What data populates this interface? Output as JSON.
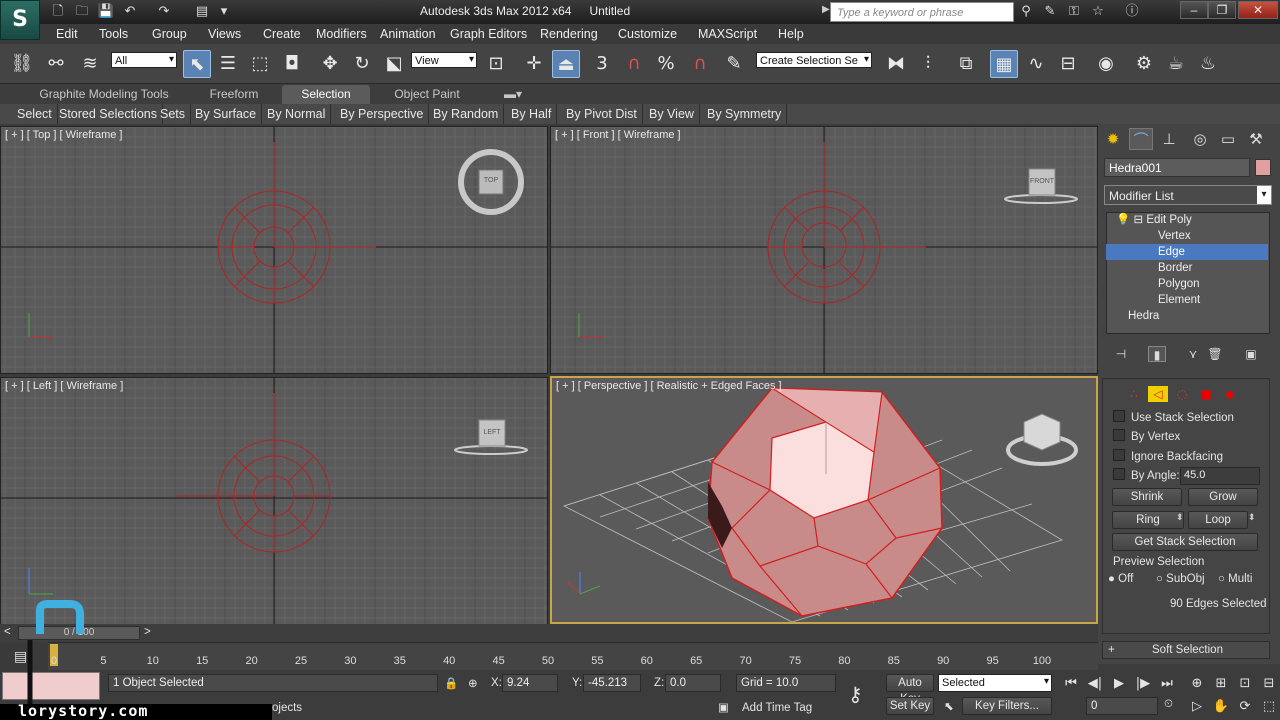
{
  "window": {
    "app_title": "Autodesk 3ds Max  2012 x64",
    "doc_title": "Untitled",
    "search_placeholder": "Type a keyword or phrase",
    "logo": "S"
  },
  "menus": [
    "Edit",
    "Tools",
    "Group",
    "Views",
    "Create",
    "Modifiers",
    "Animation",
    "Graph Editors",
    "Rendering",
    "Customize",
    "MAXScript",
    "Help"
  ],
  "toolbar": {
    "filter_value": "All",
    "coord_value": "View",
    "named_sel_value": "Create Selection Se",
    "snap_angle_label": "3",
    "percent_label": "%"
  },
  "ribbon": {
    "tabs": [
      "Graphite Modeling Tools",
      "Freeform",
      "Selection",
      "Object Paint"
    ],
    "buttons": [
      "Select",
      "Stored Selections",
      "Sets",
      "By Surface",
      "By Normal",
      "By Perspective",
      "By Random",
      "By Half",
      "By Pivot Dist",
      "By View",
      "By Symmetry"
    ]
  },
  "viewports": {
    "top": {
      "label": "[ + ] [ Top ] [ Wireframe ]",
      "cube": "TOP"
    },
    "front": {
      "label": "[ + ] [ Front ] [ Wireframe ]",
      "cube": "FRONT"
    },
    "left": {
      "label": "[ + ] [ Left ] [ Wireframe ]",
      "cube": "LEFT"
    },
    "perspective": {
      "label": "[ + ] [ Perspective ] [ Realistic + Edged Faces ]"
    }
  },
  "command_panel": {
    "object_name": "Hedra001",
    "object_color": "#e0a0a0",
    "modifier_list": "Modifier List",
    "stack": {
      "modifier": "Edit Poly",
      "subs": [
        "Vertex",
        "Edge",
        "Border",
        "Polygon",
        "Element"
      ],
      "selected": "Edge",
      "base": "Hedra"
    },
    "selection": {
      "use_stack": "Use Stack Selection",
      "by_vertex": "By Vertex",
      "ignore_backfacing": "Ignore Backfacing",
      "by_angle": "By Angle:",
      "angle_value": "45.0",
      "shrink": "Shrink",
      "grow": "Grow",
      "ring": "Ring",
      "loop": "Loop",
      "get_stack": "Get Stack Selection",
      "preview_title": "Preview Selection",
      "preview_options": [
        "Off",
        "SubObj",
        "Multi"
      ],
      "status": "90 Edges Selected"
    },
    "soft_selection": "Soft Selection"
  },
  "timeline": {
    "slider": "0 / 100",
    "ticks": [
      "0",
      "5",
      "10",
      "15",
      "20",
      "25",
      "30",
      "35",
      "40",
      "45",
      "50",
      "55",
      "60",
      "65",
      "70",
      "75",
      "80",
      "85",
      "90",
      "95",
      "100"
    ]
  },
  "status": {
    "selected": "1 Object Selected",
    "prompt": "ojects",
    "x_label": "X:",
    "x": "9.24",
    "y_label": "Y:",
    "y": "-45.213",
    "z_label": "Z:",
    "z": "0.0",
    "grid": "Grid = 10.0",
    "add_time_tag": "Add Time Tag",
    "auto_key": "Auto Key",
    "set_key": "Set Key",
    "key_mode": "Selected",
    "key_filters": "Key Filters...",
    "frame": "0"
  },
  "watermark": "lorystory.com",
  "colors": {
    "selection_blue": "#4a79c0",
    "viewport_bg": "#5a5a5a",
    "wire_red": "#b02424",
    "active_border": "#c8a548"
  }
}
